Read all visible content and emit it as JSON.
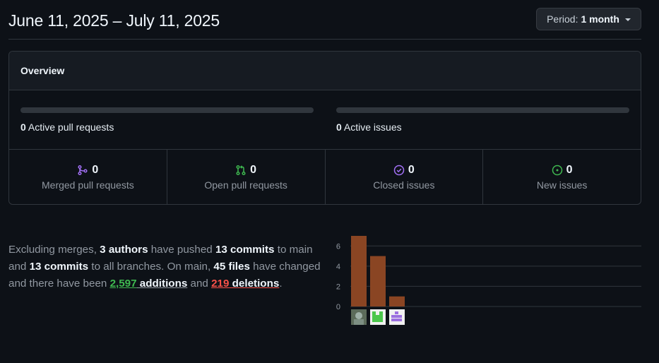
{
  "header": {
    "date_range": "June 11, 2025 – July 11, 2025",
    "period_label": "Period:",
    "period_value": "1 month"
  },
  "overview": {
    "title": "Overview",
    "active_prs_count": "0",
    "active_prs_label": "Active pull requests",
    "active_issues_count": "0",
    "active_issues_label": "Active issues",
    "stats": [
      {
        "count": "0",
        "label": "Merged pull requests",
        "icon": "git-merge-icon",
        "color": "#a371f7"
      },
      {
        "count": "0",
        "label": "Open pull requests",
        "icon": "git-pull-request-icon",
        "color": "#3fb950"
      },
      {
        "count": "0",
        "label": "Closed issues",
        "icon": "issue-closed-icon",
        "color": "#a371f7"
      },
      {
        "count": "0",
        "label": "New issues",
        "icon": "issue-opened-icon",
        "color": "#3fb950"
      }
    ]
  },
  "summary": {
    "t1": "Excluding merges, ",
    "authors": "3 authors",
    "t2": " have pushed ",
    "commits_main": "13 commits",
    "t3": " to main and ",
    "commits_all": "13 commits",
    "t4": " to all branches. On main, ",
    "files": "45 files",
    "t5": " have changed and there have been ",
    "additions_num": "2,597",
    "additions_word": " additions",
    "t6": " and ",
    "deletions_num": "219",
    "deletions_word": " deletions",
    "t7": "."
  },
  "chart_data": {
    "type": "bar",
    "categories": [
      "author-1",
      "author-2",
      "author-3"
    ],
    "values": [
      7,
      5,
      1
    ],
    "yticks": [
      0,
      2,
      4,
      6
    ],
    "ylim": [
      0,
      7
    ],
    "bar_color": "#8a4523",
    "grid": true
  }
}
